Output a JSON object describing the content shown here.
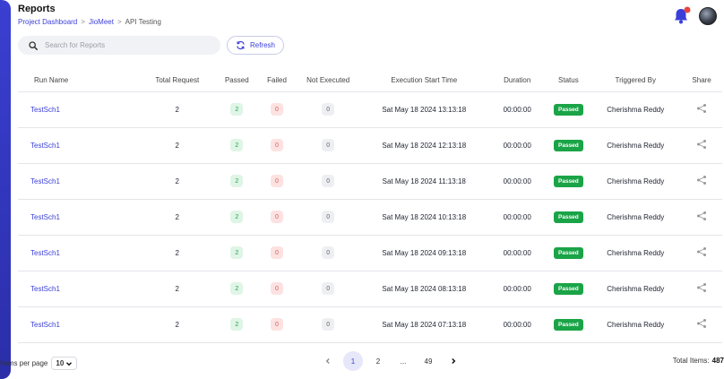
{
  "header": {
    "title": "Reports",
    "breadcrumb": [
      "Project Dashboard",
      "JioMeet",
      "API Testing"
    ],
    "breadcrumb_sep": ">"
  },
  "search": {
    "placeholder": "Search for Reports",
    "value": ""
  },
  "refresh_label": "Refresh",
  "table": {
    "columns": [
      "Run Name",
      "Total Request",
      "Passed",
      "Failed",
      "Not Executed",
      "Execution Start Time",
      "Duration",
      "Status",
      "Triggered By",
      "Share"
    ],
    "rows": [
      {
        "run_name": "TestSch1",
        "total": "2",
        "passed": "2",
        "failed": "0",
        "not_executed": "0",
        "start_time": "Sat May 18 2024 13:13:18",
        "duration": "00:00:00",
        "status": "Passed",
        "triggered_by": "Cherishma Reddy"
      },
      {
        "run_name": "TestSch1",
        "total": "2",
        "passed": "2",
        "failed": "0",
        "not_executed": "0",
        "start_time": "Sat May 18 2024 12:13:18",
        "duration": "00:00:00",
        "status": "Passed",
        "triggered_by": "Cherishma Reddy"
      },
      {
        "run_name": "TestSch1",
        "total": "2",
        "passed": "2",
        "failed": "0",
        "not_executed": "0",
        "start_time": "Sat May 18 2024 11:13:18",
        "duration": "00:00:00",
        "status": "Passed",
        "triggered_by": "Cherishma Reddy"
      },
      {
        "run_name": "TestSch1",
        "total": "2",
        "passed": "2",
        "failed": "0",
        "not_executed": "0",
        "start_time": "Sat May 18 2024 10:13:18",
        "duration": "00:00:00",
        "status": "Passed",
        "triggered_by": "Cherishma Reddy"
      },
      {
        "run_name": "TestSch1",
        "total": "2",
        "passed": "2",
        "failed": "0",
        "not_executed": "0",
        "start_time": "Sat May 18 2024 09:13:18",
        "duration": "00:00:00",
        "status": "Passed",
        "triggered_by": "Cherishma Reddy"
      },
      {
        "run_name": "TestSch1",
        "total": "2",
        "passed": "2",
        "failed": "0",
        "not_executed": "0",
        "start_time": "Sat May 18 2024 08:13:18",
        "duration": "00:00:00",
        "status": "Passed",
        "triggered_by": "Cherishma Reddy"
      },
      {
        "run_name": "TestSch1",
        "total": "2",
        "passed": "2",
        "failed": "0",
        "not_executed": "0",
        "start_time": "Sat May 18 2024 07:13:18",
        "duration": "00:00:00",
        "status": "Passed",
        "triggered_by": "Cherishma Reddy"
      }
    ]
  },
  "footer": {
    "items_per_page_label": "Items per page",
    "items_per_page_value": "10",
    "pages": [
      "1",
      "2",
      "...",
      "49"
    ],
    "current_page": "1",
    "total_label": "Total Items:",
    "total_value": "487"
  },
  "icons": {
    "search": "search-icon",
    "refresh": "refresh-icon",
    "notification": "bell-icon",
    "share": "share-icon",
    "prev": "chevron-left-icon",
    "next": "chevron-right-icon",
    "dropdown": "chevron-down-icon"
  },
  "colors": {
    "accent": "#3b3fd8",
    "passed_badge": "#1aa447",
    "notification_bell": "#3b3fd8",
    "notification_dot": "#e8453c"
  }
}
